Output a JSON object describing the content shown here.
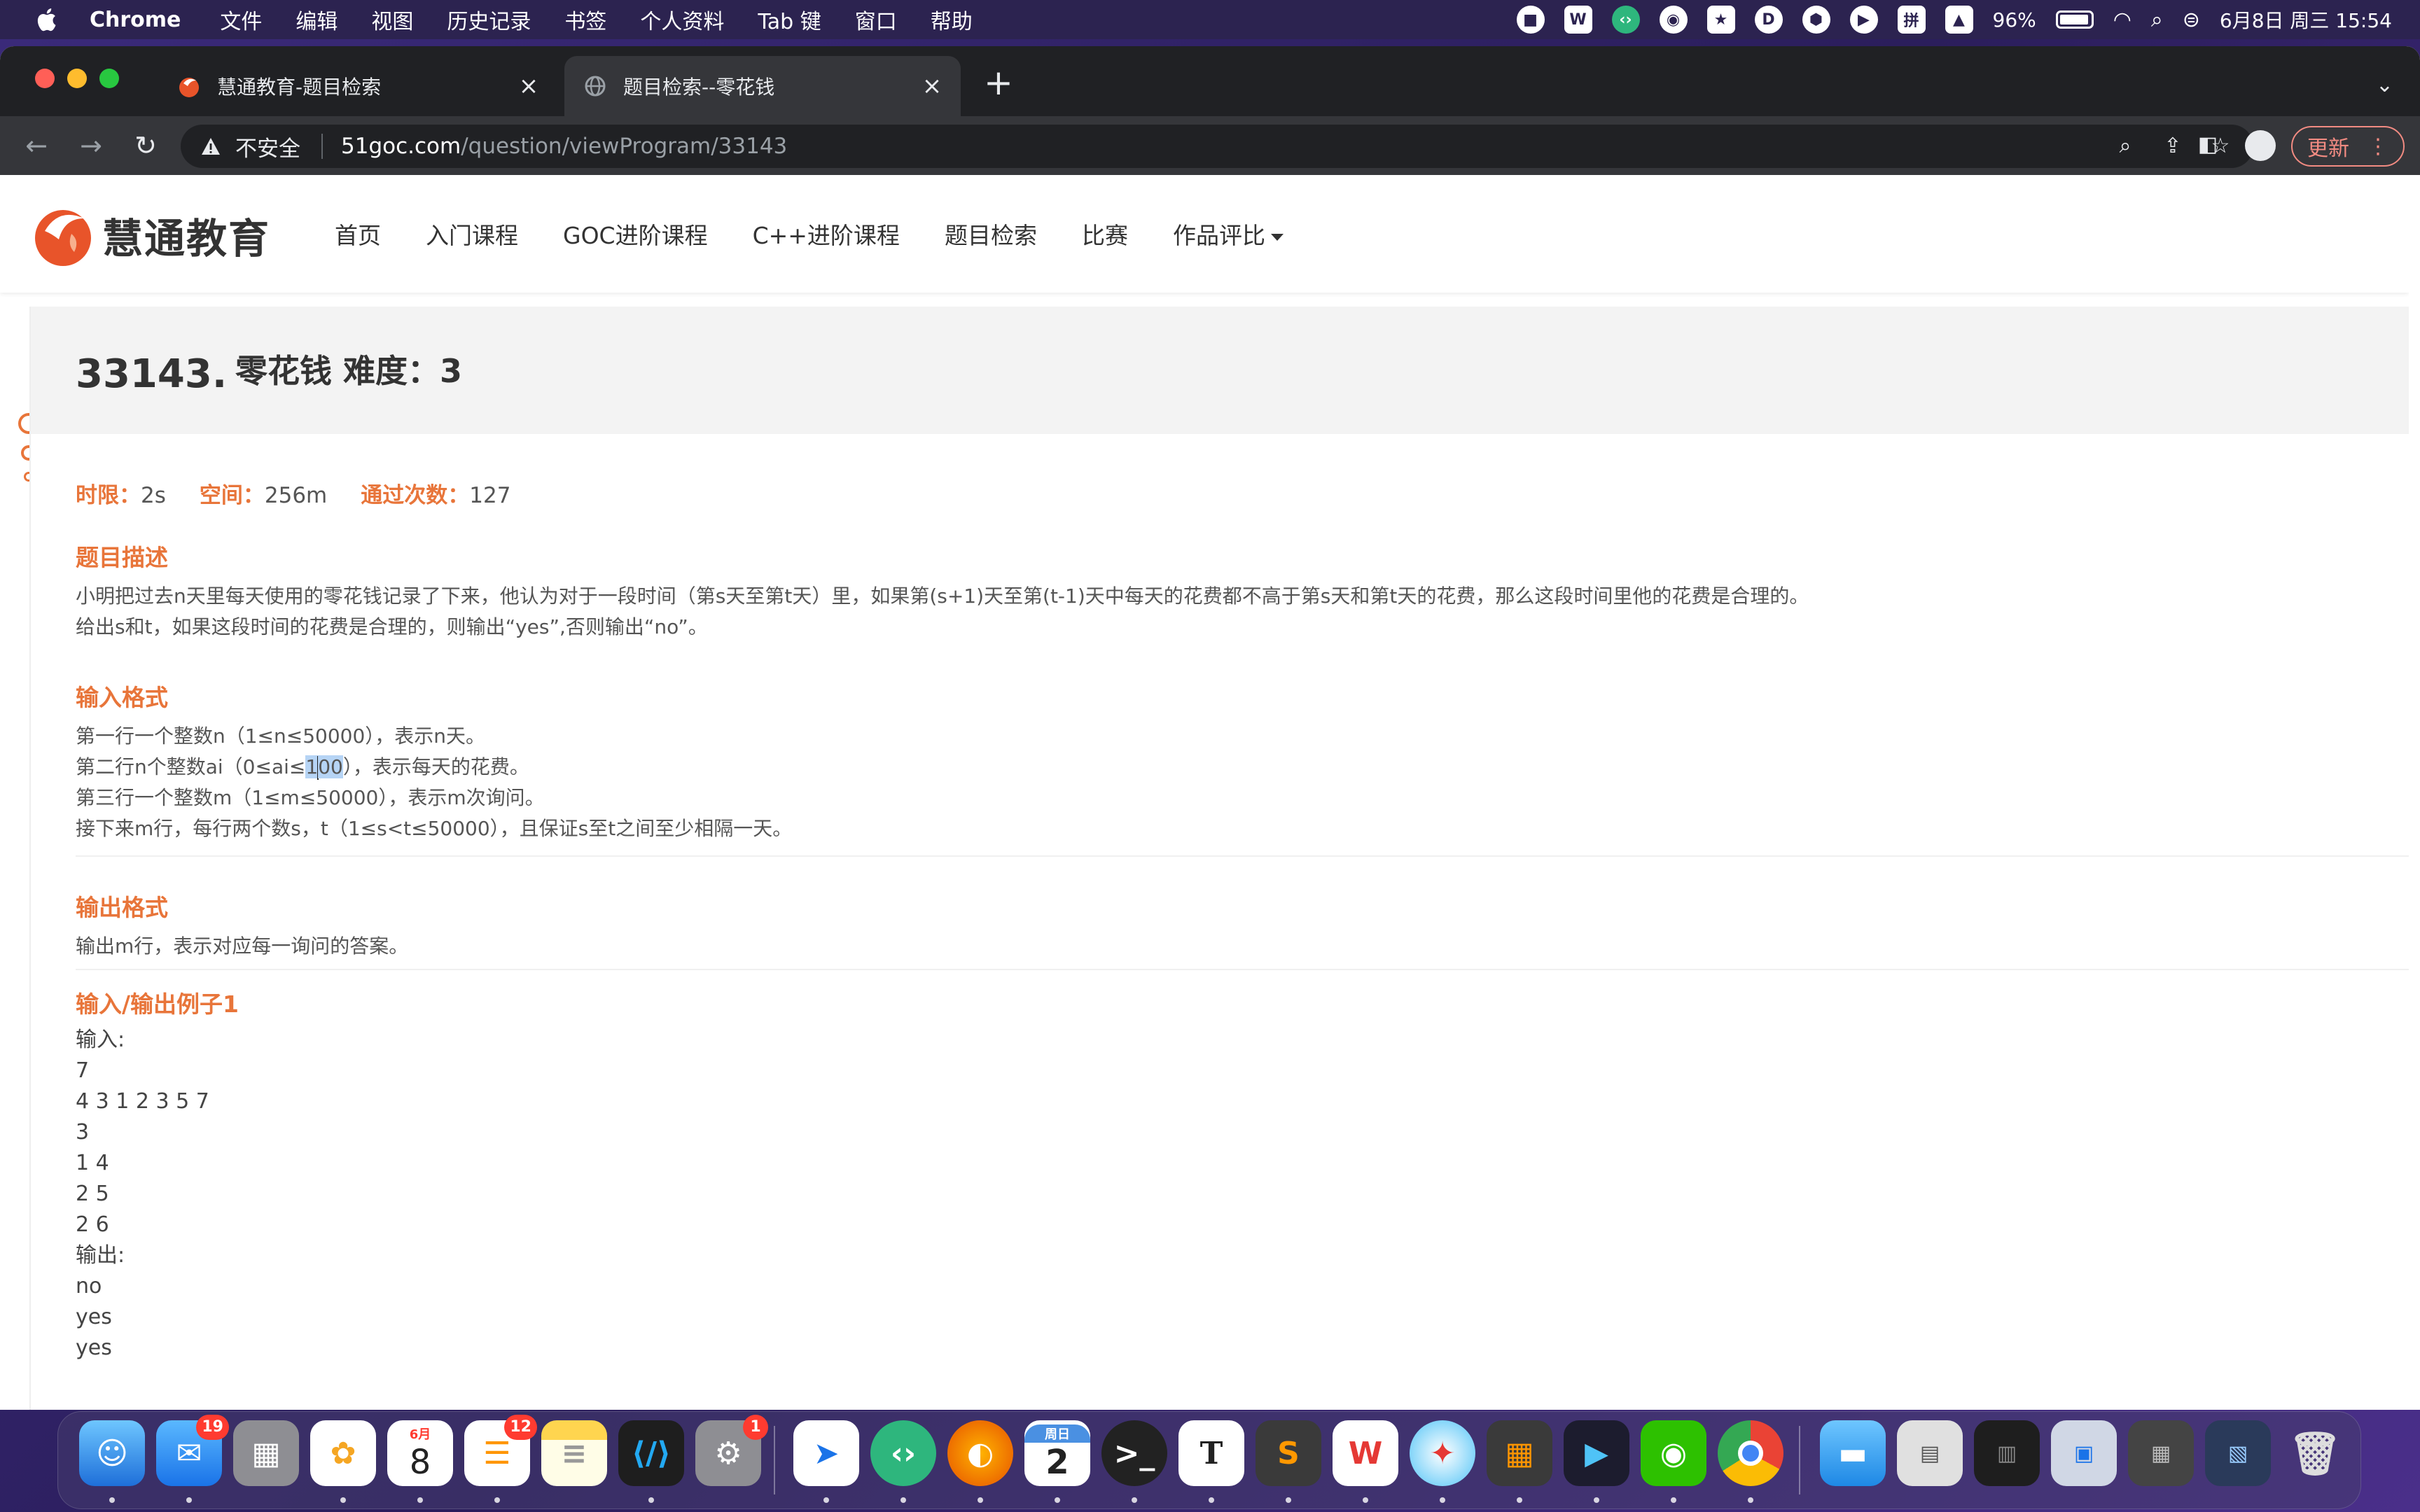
{
  "menubar": {
    "app": "Chrome",
    "items": [
      "文件",
      "编辑",
      "视图",
      "历史记录",
      "书签",
      "个人资料",
      "Tab 键",
      "窗口",
      "帮助"
    ],
    "status_icons": [
      "stop-icon",
      "wps-icon",
      "code-icon",
      "wechat-icon",
      "box-icon",
      "d-icon",
      "shield-icon",
      "play-icon",
      "pinyin-icon",
      "photo-icon"
    ],
    "pinyin": "拼",
    "d_letter": "D",
    "battery": "96%",
    "datetime": "6月8日 周三  15:54"
  },
  "tabs": [
    {
      "title": "慧通教育-题目检索",
      "active": false
    },
    {
      "title": "题目检索--零花钱",
      "active": true
    }
  ],
  "toolbar": {
    "insecure_label": "不安全",
    "url_host": "51goc.com",
    "url_path": "/question/viewProgram/33143",
    "update_label": "更新"
  },
  "site": {
    "logo_text": "慧通教育",
    "nav": [
      "首页",
      "入门课程",
      "GOC进阶课程",
      "C++进阶课程",
      "题目检索",
      "比赛",
      "作品评比"
    ]
  },
  "problem": {
    "id": "33143.",
    "title": "零花钱  难度：3",
    "time_label": "时限：",
    "time_value": "2s",
    "space_label": "空间：",
    "space_value": "256m",
    "pass_label": "通过次数：",
    "pass_value": "127",
    "desc_heading": "题目描述",
    "desc_lines": [
      "小明把过去n天里每天使用的零花钱记录了下来，他认为对于一段时间（第s天至第t天）里，如果第(s+1)天至第(t-1)天中每天的花费都不高于第s天和第t天的花费，那么这段时间里他的花费是合理的。",
      "给出s和t，如果这段时间的花费是合理的，则输出“yes”,否则输出“no”。"
    ],
    "input_heading": "输入格式",
    "input_line1": "第一行一个整数n（1≤n≤50000），表示n天。",
    "input_line2_pre": "第二行n个整数ai（0≤ai≤",
    "input_line2_hl_a": "1",
    "input_line2_hl_b": "00",
    "input_line2_post": "），表示每天的花费。",
    "input_line3": "第三行一个整数m（1≤m≤50000），表示m次询问。",
    "input_line4": "接下来m行，每行两个数s，t（1≤s<t≤50000），且保证s至t之间至少相隔一天。",
    "output_heading": "输出格式",
    "output_line": "输出m行，表示对应每一询问的答案。",
    "example_heading": "输入/输出例子1",
    "sample_lines": [
      "输入:",
      "7",
      "4 3 1 2 3 5 7",
      "3",
      "1 4",
      "2 5",
      "2 6",
      "输出:",
      "no",
      "yes",
      "yes"
    ]
  },
  "dock": {
    "apps": [
      "finder",
      "mail",
      "launchpad",
      "photos",
      "calendar",
      "reminders",
      "notes",
      "vscode",
      "system-preferences",
      "feishu",
      "code-helper",
      "firefox",
      "calendar-2",
      "terminal",
      "typora",
      "sublime",
      "wps",
      "safari",
      "calculator",
      "presentation",
      "wechat",
      "chrome",
      "folder",
      "preview-stack",
      "screen-stack",
      "screen-stack-2",
      "screen-stack-3",
      "trash"
    ],
    "mail_badge": "19",
    "reminders_badge": "12",
    "settings_badge": "1",
    "calendar_month": "6月",
    "calendar_day": "8",
    "calendar2_label": "周日",
    "calendar2_day": "2",
    "typora_letter": "T"
  }
}
